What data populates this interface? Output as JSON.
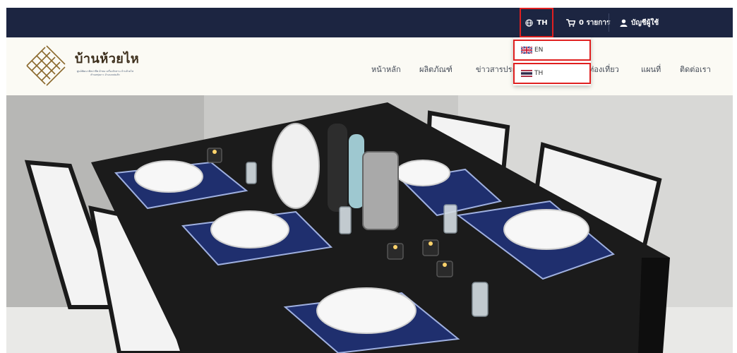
{
  "topbar": {
    "language_label": "TH",
    "cart_label": "0 รายการ",
    "account_label": "บัญชีผู้ใช้"
  },
  "brand": {
    "name": "บ้านห้วยไห",
    "tagline": "ศูนย์พัฒนาศิลปาชีพ ผ้าทอ เครื่องจักสาน บ้านห้วยไห ตำบลทุ่งยาว อำเภอหล่มสัก"
  },
  "nav": {
    "items": [
      {
        "label": "หน้าหลัก"
      },
      {
        "label": "ผลิตภัณฑ์"
      },
      {
        "label": "ข่าวสารประ"
      },
      {
        "label": "ท่องเที่ยว"
      },
      {
        "label": "แผนที่"
      },
      {
        "label": "ติดต่อเรา"
      }
    ]
  },
  "language_menu": {
    "options": [
      {
        "code": "EN"
      },
      {
        "code": "TH"
      }
    ]
  },
  "colors": {
    "topbar_bg": "#1c2541",
    "highlight_outline": "#e02020",
    "navbar_bg": "#fbfaf4"
  },
  "icons": {
    "language": "globe-icon",
    "cart": "cart-icon",
    "account": "user-icon"
  }
}
